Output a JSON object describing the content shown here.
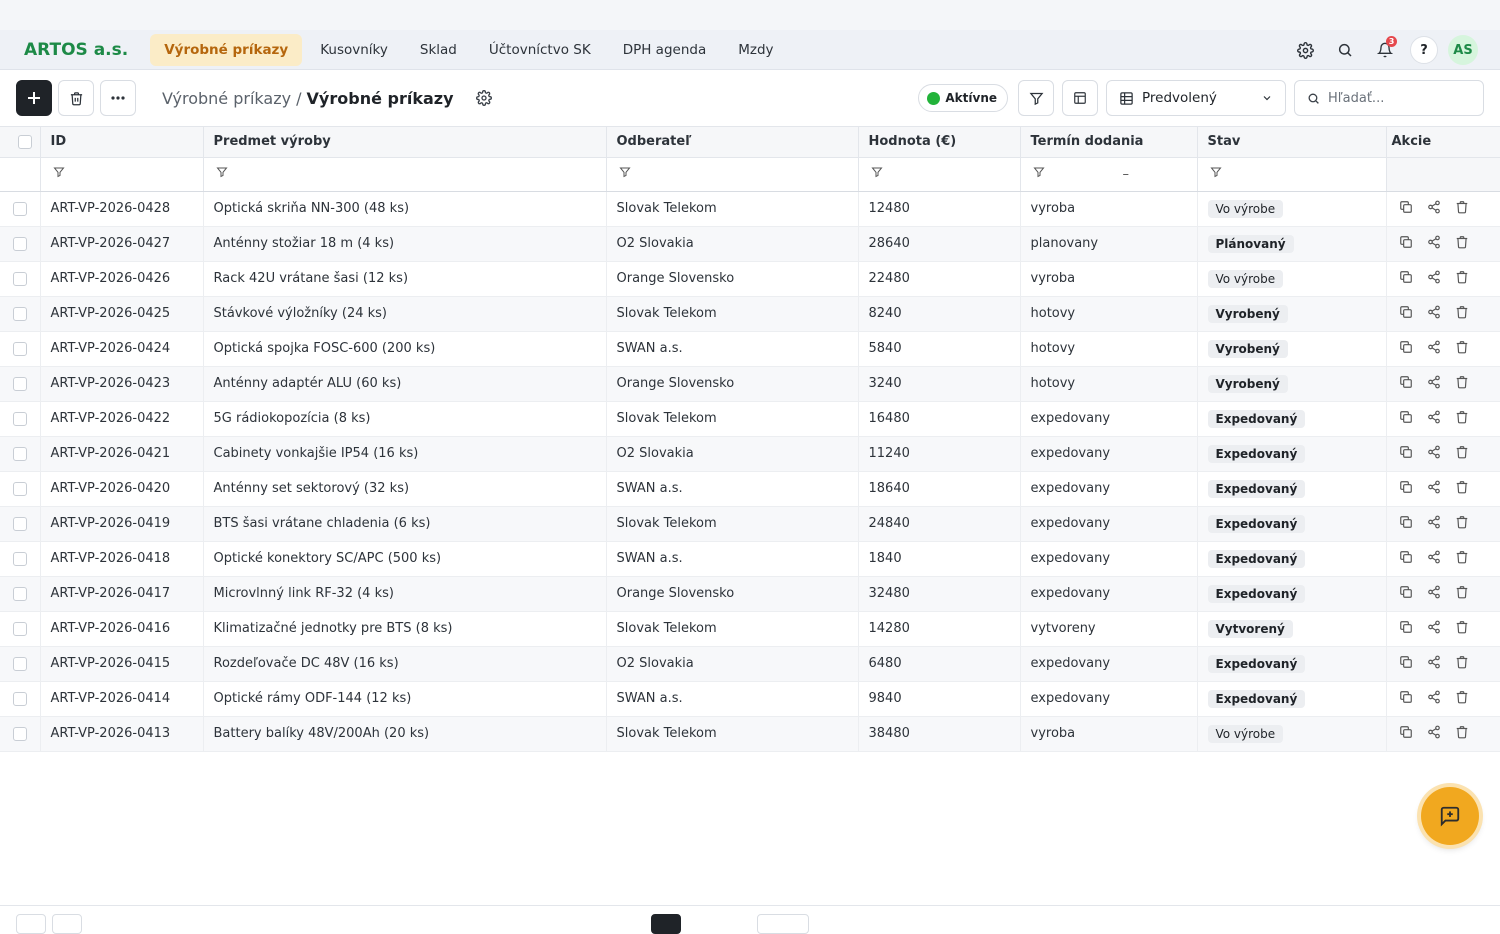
{
  "nav": {
    "brand": "ARTOS a.s.",
    "items": [
      "Výrobné príkazy",
      "Kusovníky",
      "Sklad",
      "Účtovníctvo SK",
      "DPH agenda",
      "Mzdy"
    ],
    "notifications_count": "3",
    "help_label": "?",
    "avatar_initials": "AS"
  },
  "toolbar": {
    "breadcrumb_parent": "Výrobné príkazy /",
    "breadcrumb_current": "Výrobné príkazy",
    "status_label": "Aktívne",
    "view_label": "Predvolený",
    "search_placeholder": "Hľadať..."
  },
  "table": {
    "columns": [
      "ID",
      "Predmet výroby",
      "Odberateľ",
      "Hodnota (€)",
      "Termín dodania",
      "Stav",
      "Akcie"
    ],
    "range_separator": "–",
    "rows": [
      [
        "ART-VP-2026-0428",
        "Optická skriňa NN-300 (48 ks)",
        "Slovak Telekom",
        "12480",
        "vyroba",
        "Vo výrobe"
      ],
      [
        "ART-VP-2026-0427",
        "Anténny stožiar 18 m (4 ks)",
        "O2 Slovakia",
        "28640",
        "planovany",
        "Plánovaný"
      ],
      [
        "ART-VP-2026-0426",
        "Rack 42U vrátane šasi (12 ks)",
        "Orange Slovensko",
        "22480",
        "vyroba",
        "Vo výrobe"
      ],
      [
        "ART-VP-2026-0425",
        "Stávkové výložníky (24 ks)",
        "Slovak Telekom",
        "8240",
        "hotovy",
        "Vyrobený"
      ],
      [
        "ART-VP-2026-0424",
        "Optická spojka FOSC-600 (200 ks)",
        "SWAN a.s.",
        "5840",
        "hotovy",
        "Vyrobený"
      ],
      [
        "ART-VP-2026-0423",
        "Anténny adaptér ALU (60 ks)",
        "Orange Slovensko",
        "3240",
        "hotovy",
        "Vyrobený"
      ],
      [
        "ART-VP-2026-0422",
        "5G rádiokopozícia (8 ks)",
        "Slovak Telekom",
        "16480",
        "expedovany",
        "Expedovaný"
      ],
      [
        "ART-VP-2026-0421",
        "Cabinety vonkajšie IP54 (16 ks)",
        "O2 Slovakia",
        "11240",
        "expedovany",
        "Expedovaný"
      ],
      [
        "ART-VP-2026-0420",
        "Anténny set sektorový (32 ks)",
        "SWAN a.s.",
        "18640",
        "expedovany",
        "Expedovaný"
      ],
      [
        "ART-VP-2026-0419",
        "BTS šasi vrátane chladenia (6 ks)",
        "Slovak Telekom",
        "24840",
        "expedovany",
        "Expedovaný"
      ],
      [
        "ART-VP-2026-0418",
        "Optické konektory SC/APC (500 ks)",
        "SWAN a.s.",
        "1840",
        "expedovany",
        "Expedovaný"
      ],
      [
        "ART-VP-2026-0417",
        "Microvlnný link RF-32 (4 ks)",
        "Orange Slovensko",
        "32480",
        "expedovany",
        "Expedovaný"
      ],
      [
        "ART-VP-2026-0416",
        "Klimatizačné jednotky pre BTS (8 ks)",
        "Slovak Telekom",
        "14280",
        "vytvoreny",
        "Vytvorený"
      ],
      [
        "ART-VP-2026-0415",
        "Rozdeľovače DC 48V (16 ks)",
        "O2 Slovakia",
        "6480",
        "expedovany",
        "Expedovaný"
      ],
      [
        "ART-VP-2026-0414",
        "Optické rámy ODF-144 (12 ks)",
        "SWAN a.s.",
        "9840",
        "expedovany",
        "Expedovaný"
      ],
      [
        "ART-VP-2026-0413",
        "Battery balíky 48V/200Ah (20 ks)",
        "Slovak Telekom",
        "38480",
        "vyroba",
        "Vo výrobe"
      ]
    ]
  },
  "colors": {
    "brand": "#1d8a47",
    "active_nav_bg": "#fbecc7",
    "active_nav_text": "#b5660d",
    "status_dot": "#22b33a",
    "fab": "#f1a81f"
  }
}
